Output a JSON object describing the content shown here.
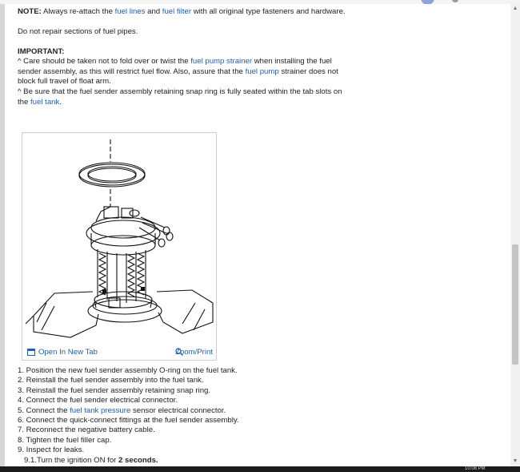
{
  "note": {
    "label": "NOTE:",
    "text_before": " Always re-attach the ",
    "link1": "fuel lines",
    "text_mid": " and ",
    "link2": "fuel filter",
    "text_after": " with all original type fasteners and hardware."
  },
  "dont_repair": "Do not repair sections of fuel pipes.",
  "important": {
    "heading": "IMPORTANT:",
    "item1": {
      "bullet": "^",
      "text_before": " Care should be taken not to fold over or twist the ",
      "link1": "fuel pump strainer",
      "text_mid": " when installing the fuel sender assembly, as this will restrict fuel flow. Also, assure that the ",
      "link2": "fuel pump",
      "text_after": " strainer does not block full travel of float arm."
    },
    "item2": {
      "bullet": "^",
      "text_before": " Be sure that the fuel sender assembly retaining snap ring is fully seated within the tab slots on the ",
      "link1": "fuel tank",
      "text_after": "."
    }
  },
  "figure": {
    "open_tab_label": "Open In New Tab",
    "zoom_label": "Zoom/Print"
  },
  "steps": [
    "1. Position the new fuel sender assembly O-ring on the fuel tank.",
    "2. Reinstall the fuel sender assembly into the fuel tank.",
    "3. Reinstall the fuel sender assembly retaining snap ring.",
    "4. Connect the fuel sender electrical connector.",
    {
      "before": "5. Connect the ",
      "link": "fuel tank pressure",
      "after": " sensor electrical connector."
    },
    "6. Connect the quick-connect fittings at the fuel sender assembly.",
    "7. Reconnect the negative battery cable.",
    "8. Tighten the fuel filler cap.",
    "9. Inspect for leaks."
  ],
  "substep": {
    "text": "9.1.Turn the ignition ON for ",
    "bold": "2 seconds."
  },
  "taskbar": {
    "clock": "10:08 PM"
  },
  "colors": {
    "link": "#1f5fb4",
    "panel": "#ffffff",
    "background": "#e9e9e9"
  }
}
